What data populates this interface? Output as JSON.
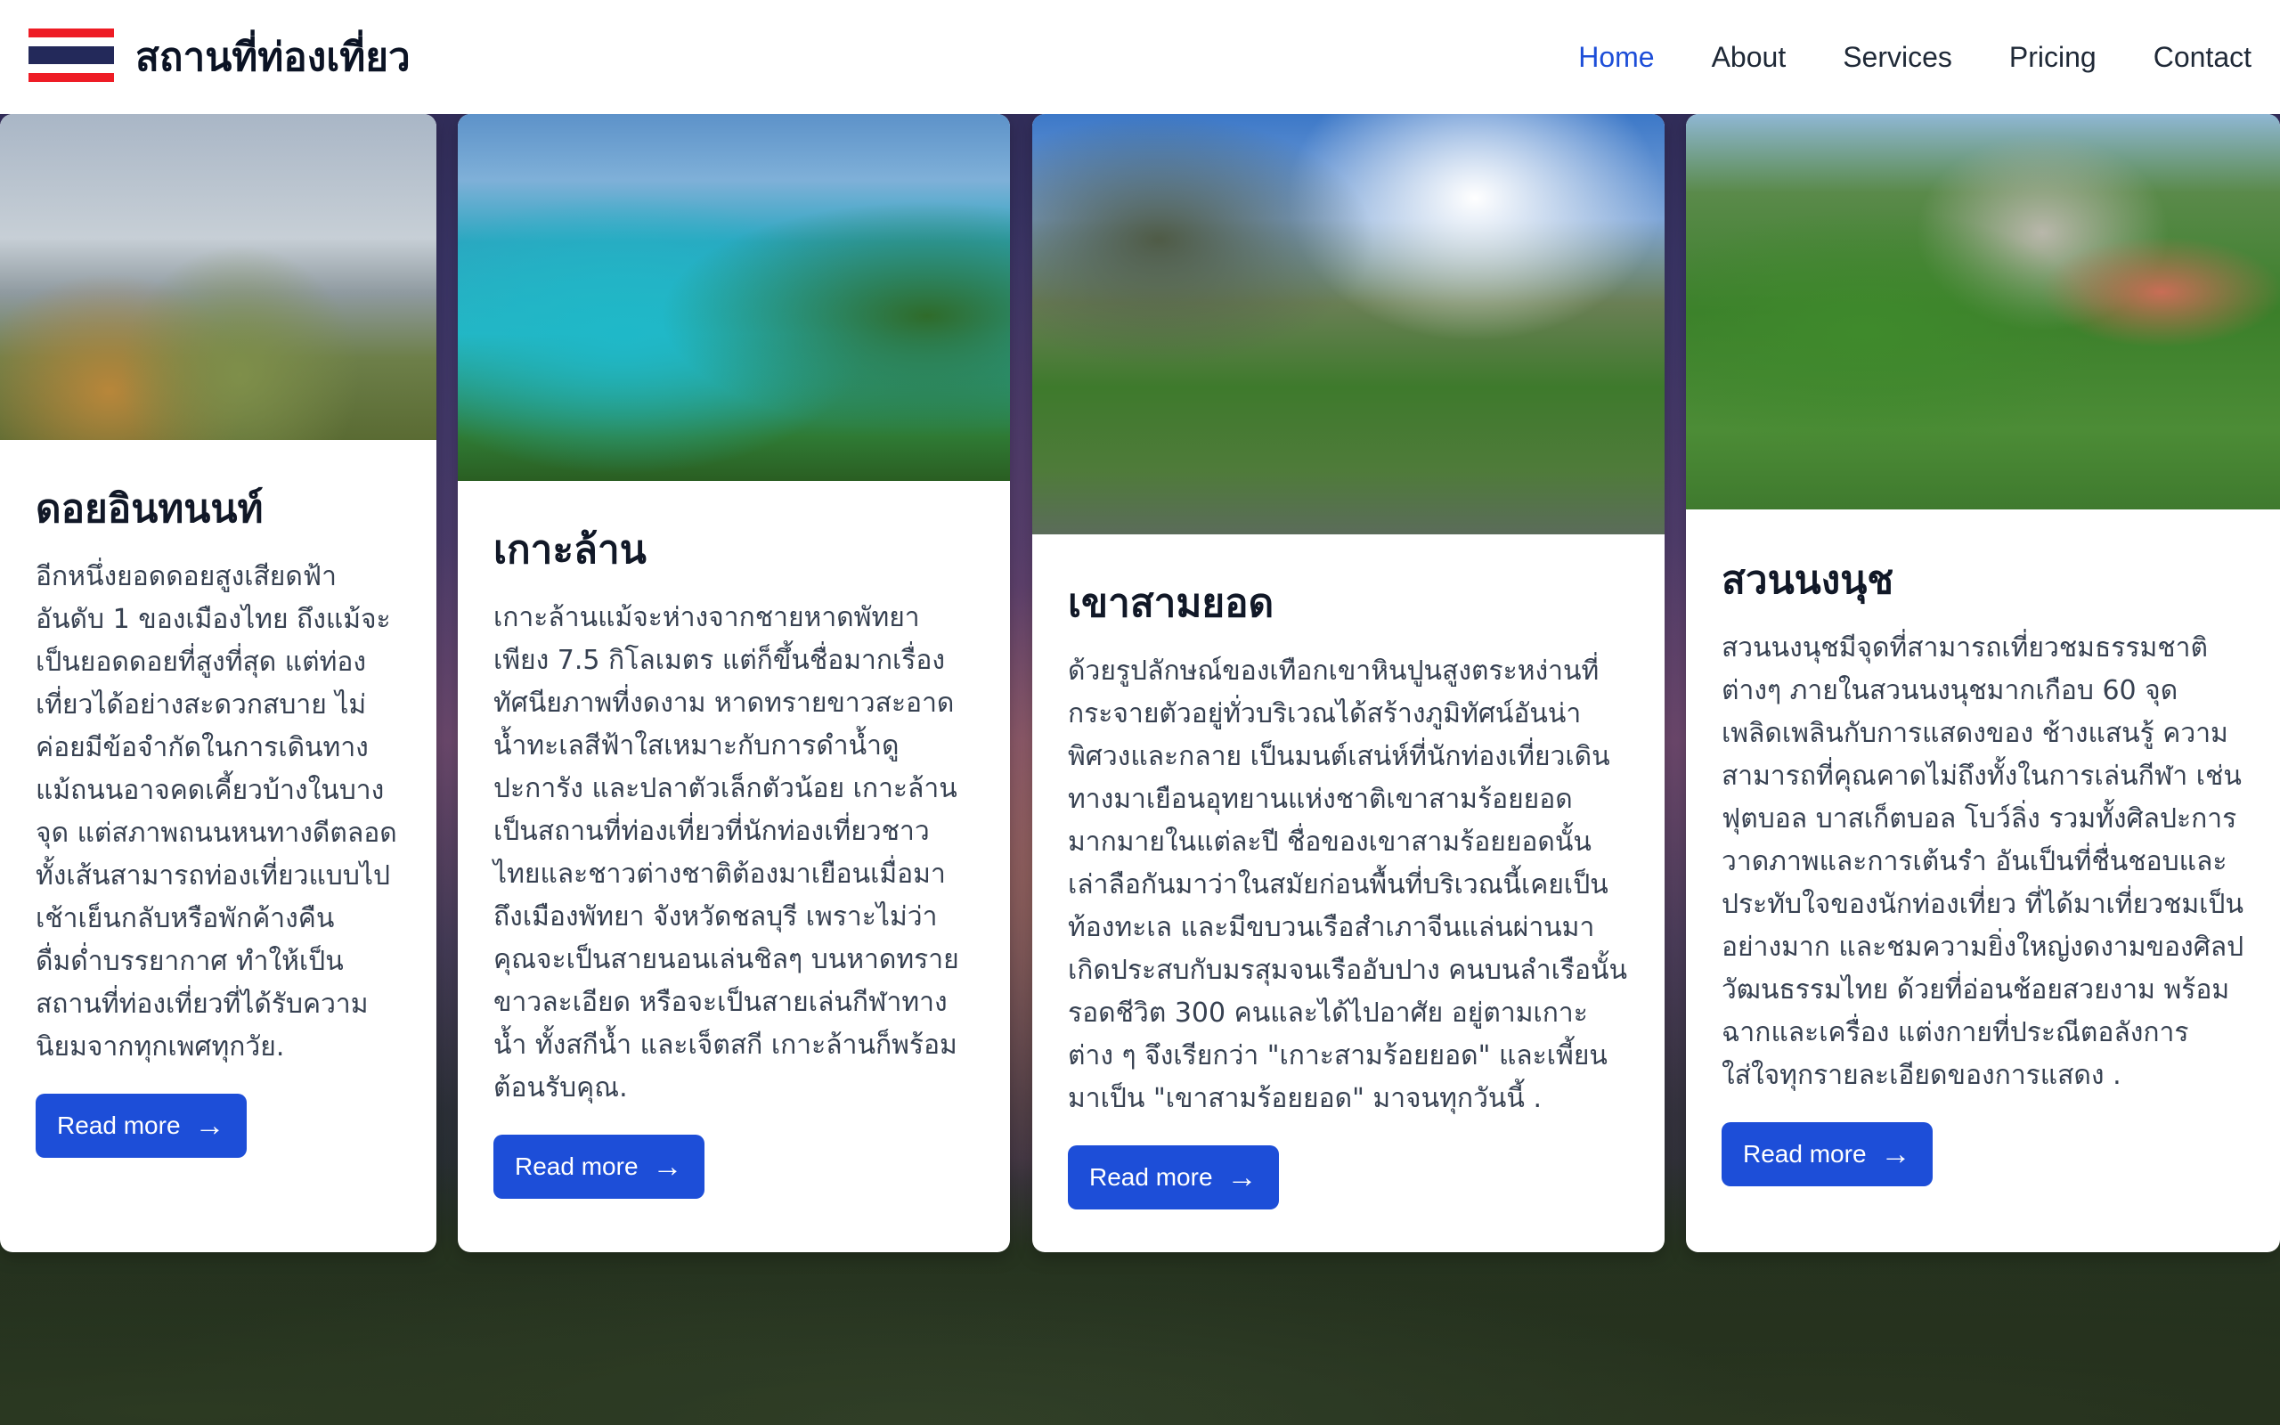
{
  "colors": {
    "accent": "#1d4ed8",
    "header_bg": "#ffffff",
    "card_bg": "#ffffff"
  },
  "header": {
    "logo_icon": "thailand-flag-icon",
    "title": "สถานที่ท่องเที่ยว",
    "nav": [
      {
        "label": "Home",
        "active": true
      },
      {
        "label": "About",
        "active": false
      },
      {
        "label": "Services",
        "active": false
      },
      {
        "label": "Pricing",
        "active": false
      },
      {
        "label": "Contact",
        "active": false
      }
    ]
  },
  "cards": [
    {
      "title": "ดอยอินทนนท์",
      "text": "อีกหนึ่งยอดดอยสูงเสียดฟ้า อันดับ 1 ของเมืองไทย ถึงแม้จะเป็นยอดดอยที่สูงที่สุด แต่ท่องเที่ยวได้อย่างสะดวกสบาย ไม่ค่อยมีข้อจำกัดในการเดินทาง แม้ถนนอาจคดเคี้ยวบ้างในบางจุด แต่สภาพถนนหนทางดีตลอดทั้งเส้นสามารถท่องเที่ยวแบบไปเช้าเย็นกลับหรือพักค้างคืนดื่มด่ำบรรยากาศ ทำให้เป็นสถานที่ท่องเที่ยวที่ได้รับความนิยมจากทุกเพศทุกวัย.",
      "button": "Read more",
      "button_icon": "arrow-right-icon"
    },
    {
      "title": "เกาะล้าน",
      "text": "เกาะล้านแม้จะห่างจากชายหาดพัทยาเพียง 7.5 กิโลเมตร แต่ก็ขึ้นชื่อมากเรื่องทัศนียภาพที่งดงาม หาดทรายขาวสะอาด น้ำทะเลสีฟ้าใสเหมาะกับการดำน้ำดูปะการัง และปลาตัวเล็กตัวน้อย เกาะล้านเป็นสถานที่ท่องเที่ยวที่นักท่องเที่ยวชาวไทยและชาวต่างชาติต้องมาเยือนเมื่อมาถึงเมืองพัทยา จังหวัดชลบุรี เพราะไม่ว่าคุณจะเป็นสายนอนเล่นชิลๆ บนหาดทรายขาวละเอียด หรือจะเป็นสายเล่นกีฬาทางน้ำ ทั้งสกีน้ำ และเจ็ตสกี เกาะล้านก็พร้อมต้อนรับคุณ.",
      "button": "Read more",
      "button_icon": "arrow-right-icon"
    },
    {
      "title": "เขาสามยอด",
      "text": "ด้วยรูปลักษณ์ของเทือกเขาหินปูนสูงตระหง่านที่กระจายตัวอยู่ทั่วบริเวณได้สร้างภูมิทัศน์อันน่าพิศวงและกลาย เป็นมนต์เสน่ห์ที่นักท่องเที่ยวเดินทางมาเยือนอุทยานแห่งชาติเขาสามร้อยยอดมากมายในแต่ละปี ชื่อของเขาสามร้อยยอดนั้นเล่าลือกันมาว่าในสมัยก่อนพื้นที่บริเวณนี้เคยเป็นท้องทะเล และมีขบวนเรือสำเภาจีนแล่นผ่านมาเกิดประสบกับมรสุมจนเรืออับปาง คนบนลำเรือนั้นรอดชีวิต 300 คนและได้ไปอาศัย อยู่ตามเกาะต่าง ๆ จึงเรียกว่า \"เกาะสามร้อยยอด\" และเพี้ยนมาเป็น \"เขาสามร้อยยอด\" มาจนทุกวันนี้ .",
      "button": "Read more",
      "button_icon": "arrow-right-icon"
    },
    {
      "title": "สวนนงนุช",
      "text": "สวนนงนุชมีจุดที่สามารถเที่ยวชมธรรมชาติต่างๆ ภายในสวนนงนุชมากเกือบ 60 จุด เพลิดเพลินกับการแสดงของ ช้างแสนรู้ ความสามารถที่คุณคาดไม่ถึงทั้งในการเล่นกีฬา เช่น ฟุตบอล บาสเก็ตบอล โบว์ลิ่ง รวมทั้งศิลปะการวาดภาพและการเต้นรำ อันเป็นที่ชื่นชอบและประทับใจของนักท่องเที่ยว ที่ได้มาเที่ยวชมเป็นอย่างมาก และชมความยิ่งใหญ่งดงามของศิลปวัฒนธรรมไทย ด้วยที่อ่อนช้อยสวยงาม พร้อมฉากและเครื่อง แต่งกายที่ประณีตอลังการใส่ใจทุกรายละเอียดของการแสดง .",
      "button": "Read more",
      "button_icon": "arrow-right-icon"
    }
  ]
}
